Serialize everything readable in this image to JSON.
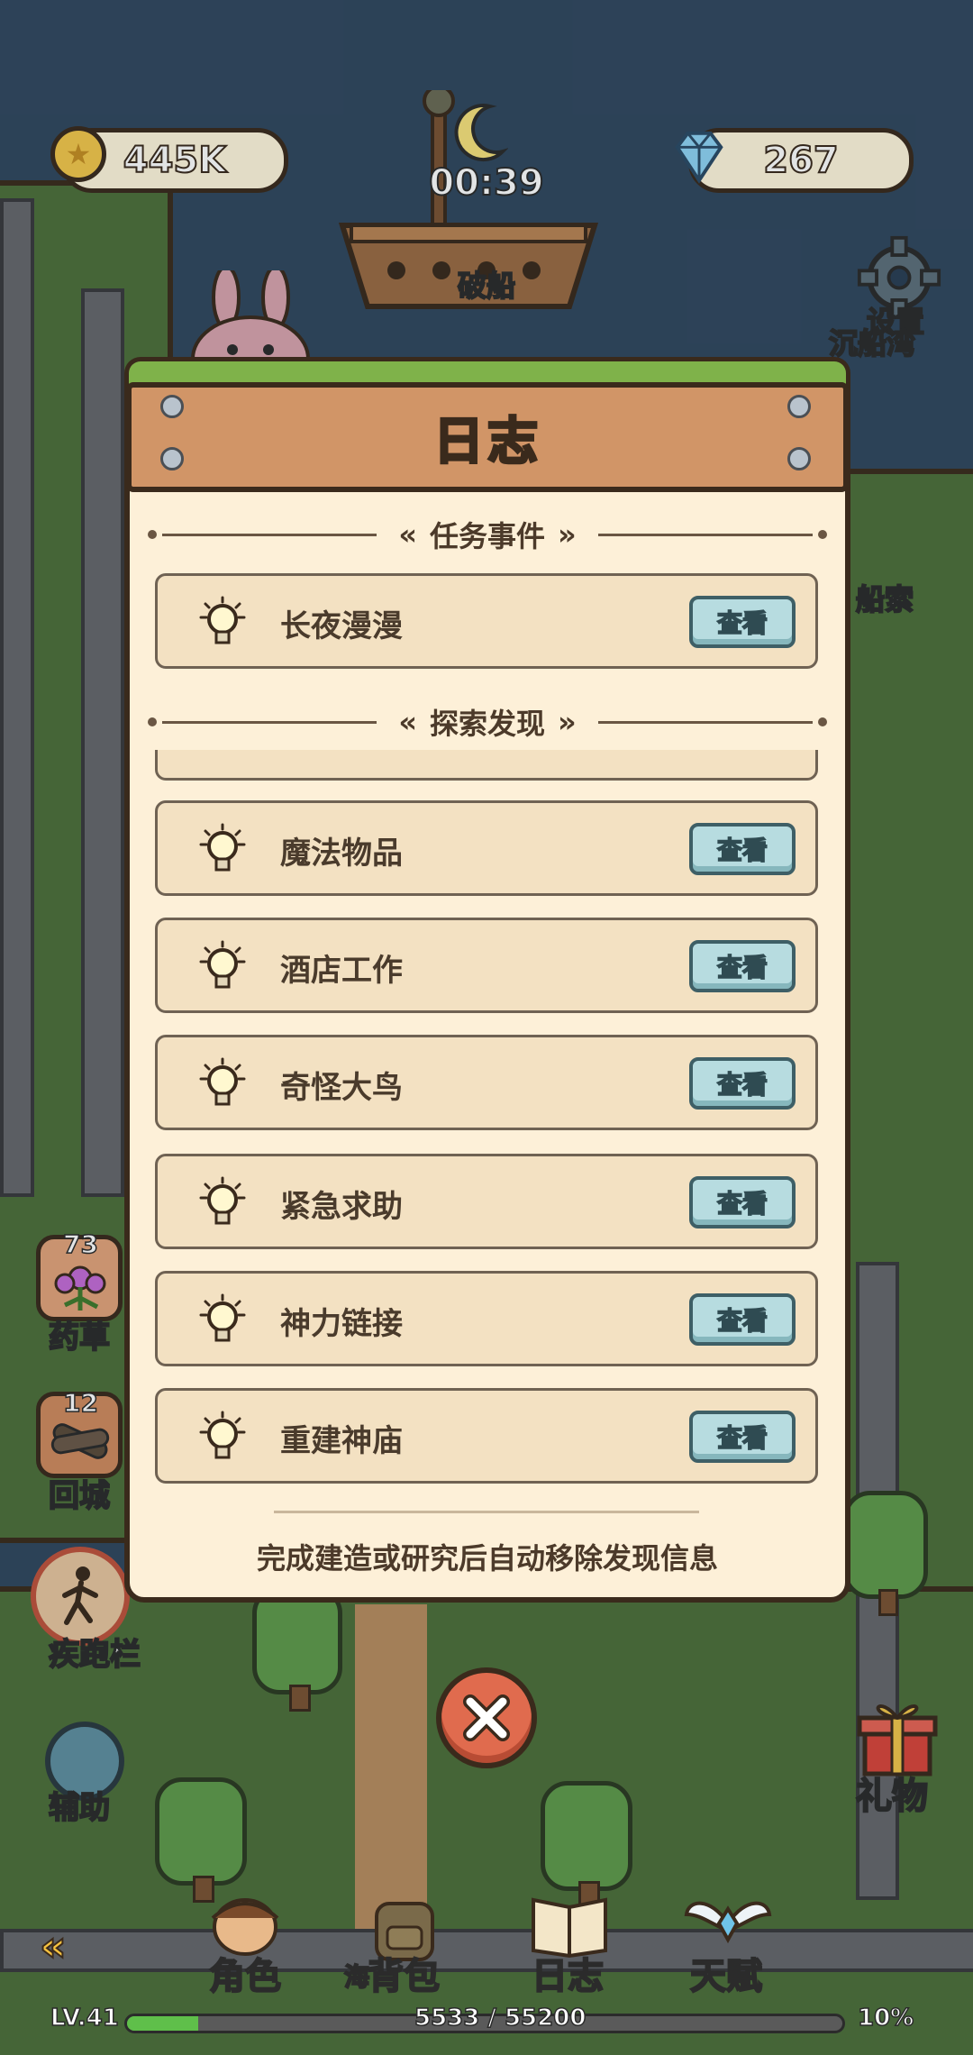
{
  "hud": {
    "coins": "445K",
    "gems": "267",
    "timer": "00:39"
  },
  "map_labels": {
    "ship": "破船",
    "settings": "设置",
    "shipwreck_bay": "沉船湾",
    "rope": "船索"
  },
  "side": {
    "herb_count": "73",
    "herb_label": "药草",
    "return_count": "12",
    "return_label": "回城",
    "sprint_label": "疾跑栏",
    "assist_label": "辅助",
    "gift_label": "礼物"
  },
  "dialog": {
    "title": "日志",
    "sections": [
      {
        "heading": "任务事件",
        "entries": [
          {
            "label": "长夜漫漫",
            "button": "查看"
          }
        ]
      },
      {
        "heading": "探索发现",
        "entries": [
          {
            "label": "魔法物品",
            "button": "查看"
          },
          {
            "label": "酒店工作",
            "button": "查看"
          },
          {
            "label": "奇怪大鸟",
            "button": "查看"
          },
          {
            "label": "紧急求助",
            "button": "查看"
          },
          {
            "label": "神力链接",
            "button": "查看"
          },
          {
            "label": "重建神庙",
            "button": "查看"
          }
        ]
      }
    ],
    "footer": "完成建造或研究后自动移除发现信息"
  },
  "nav": {
    "character": "角色",
    "backpack": "背包",
    "backpack_prefix": "海",
    "journal": "日志",
    "talent": "天赋"
  },
  "status": {
    "level": "LV.41",
    "xp": "5533 / 55200",
    "xp_fraction": 0.1,
    "percent": "10%"
  },
  "colors": {
    "panel": "#fdf0d8",
    "plank": "#d19567",
    "button": "#b7dce0",
    "close": "#e06b4e"
  }
}
